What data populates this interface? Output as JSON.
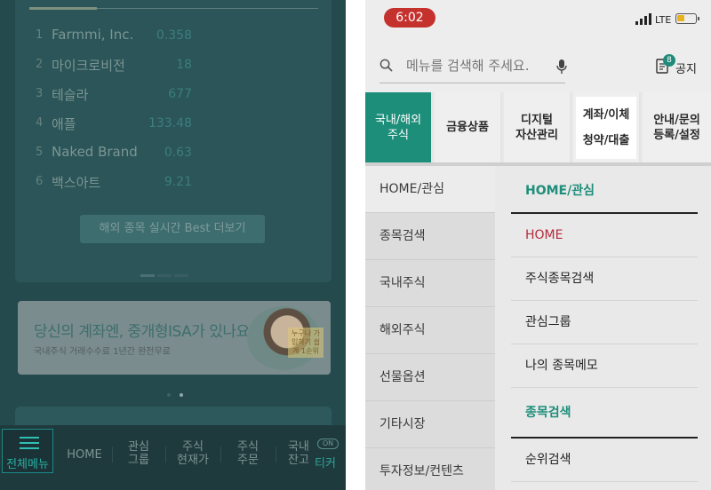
{
  "left_screen": {
    "ranking": [
      {
        "rank": "1",
        "name": "Farmmi, Inc.",
        "value": "0.358"
      },
      {
        "rank": "2",
        "name": "마이크로비전",
        "value": "18"
      },
      {
        "rank": "3",
        "name": "테슬라",
        "value": "677"
      },
      {
        "rank": "4",
        "name": "애플",
        "value": "133.48"
      },
      {
        "rank": "5",
        "name": "Naked Brand Gro",
        "value": "0.63"
      },
      {
        "rank": "6",
        "name": "백스아트",
        "value": "9.21"
      }
    ],
    "more_button": "해외 종목 실시간 Best 더보기",
    "banner": {
      "title": "당신의 계좌엔, 중개형ISA가 있나요?",
      "subtitle": "국내주식 거래수수료 1년간 완전무료",
      "tag": "누구나 가입하기 쉽게 1순위"
    },
    "bottom_nav": {
      "menu": "전체메뉴",
      "home": "HOME",
      "watch_1": "관심",
      "watch_2": "그룹",
      "quote_1": "주식",
      "quote_2": "현재가",
      "order_1": "주식",
      "order_2": "주문",
      "balance_1": "국내",
      "balance_2": "잔고",
      "toggle": "ON",
      "ticker": "티커"
    }
  },
  "right_screen": {
    "status": {
      "time": "6:02",
      "network": "LTE"
    },
    "search": {
      "placeholder": "메뉴를 검색해 주세요."
    },
    "notice": {
      "label": "공지",
      "badge": "8"
    },
    "categories": [
      {
        "line1": "국내/해외",
        "line2": "주식"
      },
      {
        "line1": "금융상품",
        "line2": ""
      },
      {
        "line1": "디지털",
        "line2": "자산관리"
      },
      {
        "line1": "계좌/이체",
        "line2": "청약/대출"
      },
      {
        "line1": "안내/문의",
        "line2": "등록/설정"
      }
    ],
    "side_menu": [
      "HOME/관심",
      "종목검색",
      "국내주식",
      "해외주식",
      "선물옵션",
      "기타시장",
      "투자정보/컨텐츠"
    ],
    "sub_menu": [
      "HOME/관심",
      "HOME",
      "주식종목검색",
      "관심그룹",
      "나의 종목메모",
      "종목검색",
      "순위검색"
    ],
    "colors": {
      "accent": "#1d8e7a",
      "highlight_red": "#b42b3d",
      "time_pill": "#c5322e"
    }
  }
}
